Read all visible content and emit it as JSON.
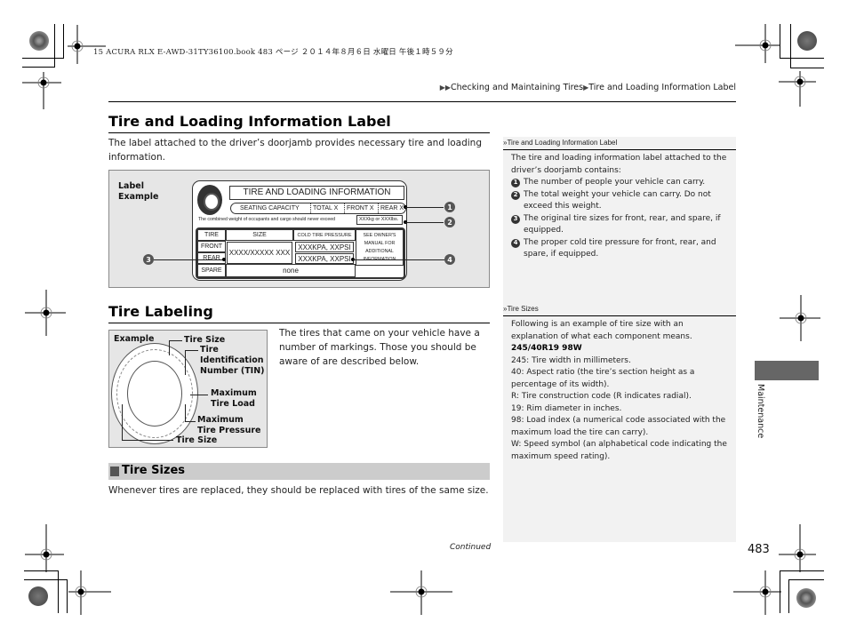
{
  "print_header": "15 ACURA RLX E-AWD-31TY36100.book  483 ページ  ２０１４年８月６日  水曜日  午後１時５９分",
  "breadcrumb": {
    "icon": "double-triangle",
    "parts": [
      "Checking and Maintaining Tires",
      "Tire and Loading Information Label"
    ],
    "separator": "▶"
  },
  "section1": {
    "title": "Tire and Loading Information Label",
    "body": "The label attached to the driver’s doorjamb provides necessary tire and loading information.",
    "figure": {
      "caption_line1": "Label",
      "caption_line2": "Example",
      "label": {
        "title": "TIRE AND LOADING INFORMATION",
        "seating_capacity": "SEATING CAPACITY",
        "total": "TOTAL  X",
        "front": "FRONT  X",
        "rear": "REAR  X",
        "weight_text": "The combined weight of occupants and cargo should never exceed",
        "weight_value": "XXXkg or XXXlbs.",
        "headers": [
          "TIRE",
          "SIZE",
          "COLD TIRE PRESSURE"
        ],
        "rows": [
          "FRONT",
          "REAR",
          "SPARE"
        ],
        "size_value": "XXXX/XXXXX XXX",
        "pressure_front": "XXXKPA, XXPSI",
        "pressure_rear": "XXXKPA, XXPSI",
        "spare_value": "none",
        "see_manual": [
          "SEE  OWNER'S",
          "MANUAL  FOR",
          "ADDITIONAL",
          "INFORMATION"
        ]
      },
      "callouts": [
        "1",
        "2",
        "3",
        "4"
      ]
    }
  },
  "section2": {
    "title": "Tire Labeling",
    "body": "The tires that came on your vehicle have a number of markings. Those you should be aware of are described below.",
    "figure": {
      "caption": "Example",
      "labels": {
        "tire_size_top": "Tire Size",
        "tin_1": "Tire",
        "tin_2": "Identification",
        "tin_3": "Number (TIN)",
        "max_load_1": "Maximum",
        "max_load_2": "Tire Load",
        "max_pressure_1": "Maximum",
        "max_pressure_2": "Tire Pressure",
        "tire_size_bottom": "Tire Size"
      }
    }
  },
  "subsection": {
    "title": "Tire Sizes",
    "body": "Whenever tires are replaced, they should be replaced with tires of the same size."
  },
  "notes": {
    "note1": {
      "heading": "Tire and Loading Information Label",
      "intro": "The tire and loading information label attached to the driver’s doorjamb contains:",
      "items": [
        {
          "num": "1",
          "text": "The number of people your vehicle can carry."
        },
        {
          "num": "2",
          "text": "The total weight your vehicle can carry. Do not exceed this weight."
        },
        {
          "num": "3",
          "text": "The original tire sizes for front, rear, and spare, if equipped."
        },
        {
          "num": "4",
          "text": "The proper cold tire pressure for front, rear, and spare, if equipped."
        }
      ]
    },
    "note2": {
      "heading": "Tire Sizes",
      "intro": "Following is an example of tire size with an explanation of what each component means.",
      "example": "245/40R19 98W",
      "lines": [
        "245: Tire width in millimeters.",
        "40: Aspect ratio (the tire’s section height as a percentage of its width).",
        "R: Tire construction code (R indicates radial).",
        "19: Rim diameter in inches.",
        "98: Load index (a numerical code associated with the maximum load the tire can carry).",
        "W: Speed symbol (an alphabetical code indicating the maximum speed rating)."
      ]
    }
  },
  "side_tab": "Maintenance",
  "continued": "Continued",
  "page_number": "483",
  "colors": {
    "figure_bg": "#e6e6e6",
    "sidebar_bg": "#f2f2f2",
    "subhead_bg": "#cccccc",
    "tab_marker": "#666666"
  }
}
